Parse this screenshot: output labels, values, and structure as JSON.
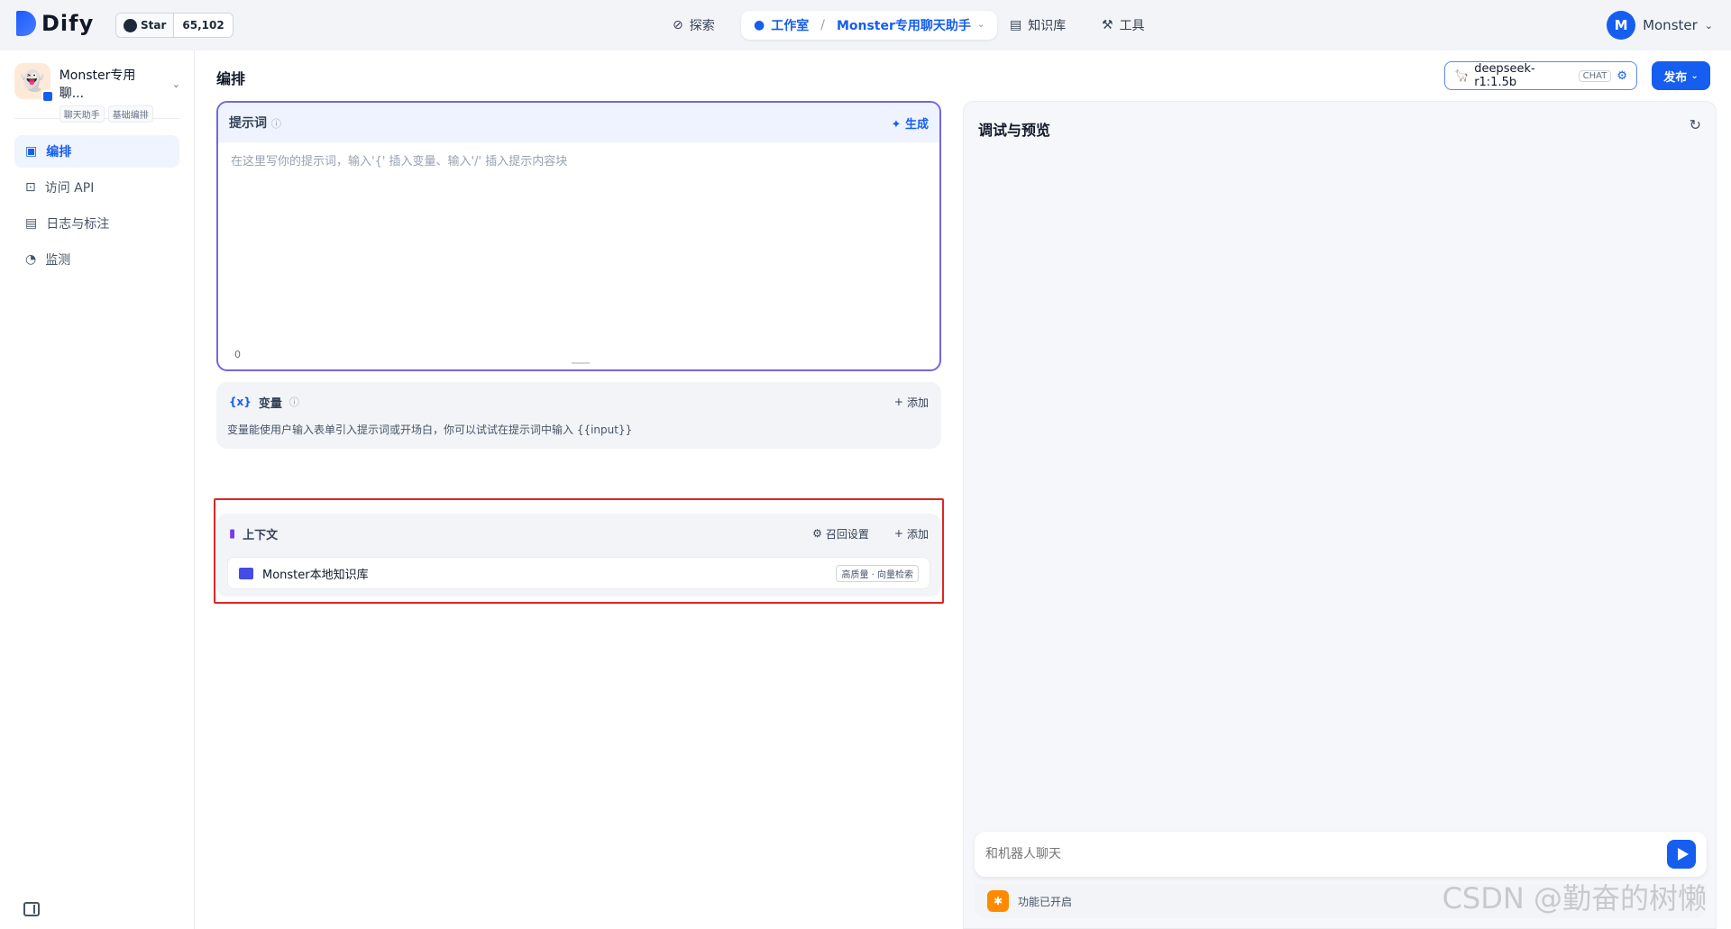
{
  "topbar": {
    "logo_text": "Dify",
    "star_label": "Star",
    "star_count": "65,102",
    "nav": {
      "explore": "探索",
      "studio": "工作室",
      "app_breadcrumb": "Monster专用聊天助手",
      "knowledge": "知识库",
      "tools": "工具"
    },
    "user": {
      "initial": "M",
      "name": "Monster"
    }
  },
  "sidebar": {
    "app_name": "Monster专用聊...",
    "tags": [
      "聊天助手",
      "基础编排"
    ],
    "items": [
      {
        "label": "编排",
        "icon": "layout-icon",
        "active": true
      },
      {
        "label": "访问 API",
        "icon": "terminal-icon",
        "active": false
      },
      {
        "label": "日志与标注",
        "icon": "file-list-icon",
        "active": false
      },
      {
        "label": "监测",
        "icon": "dashboard-icon",
        "active": false
      }
    ]
  },
  "main": {
    "title": "编排",
    "model": {
      "name": "deepseek-r1:1.5b",
      "tag": "CHAT"
    },
    "publish_label": "发布",
    "prompt": {
      "title": "提示词",
      "generate_label": "生成",
      "placeholder": "在这里写你的提示词，输入'{' 插入变量、输入'/' 插入提示内容块",
      "char_count": "0"
    },
    "variables": {
      "title": "变量",
      "add_label": "添加",
      "description": "变量能使用户输入表单引入提示词或开场白，你可以试试在提示词中输入 {{input}}"
    },
    "context": {
      "title": "上下文",
      "recall_label": "召回设置",
      "add_label": "添加",
      "knowledge_name": "Monster本地知识库",
      "knowledge_tag": "高质量 · 向量检索"
    }
  },
  "preview": {
    "title": "调试与预览",
    "input_placeholder": "和机器人聊天",
    "feature_label": "功能已开启"
  },
  "watermark": "CSDN @勤奋的树懒"
}
